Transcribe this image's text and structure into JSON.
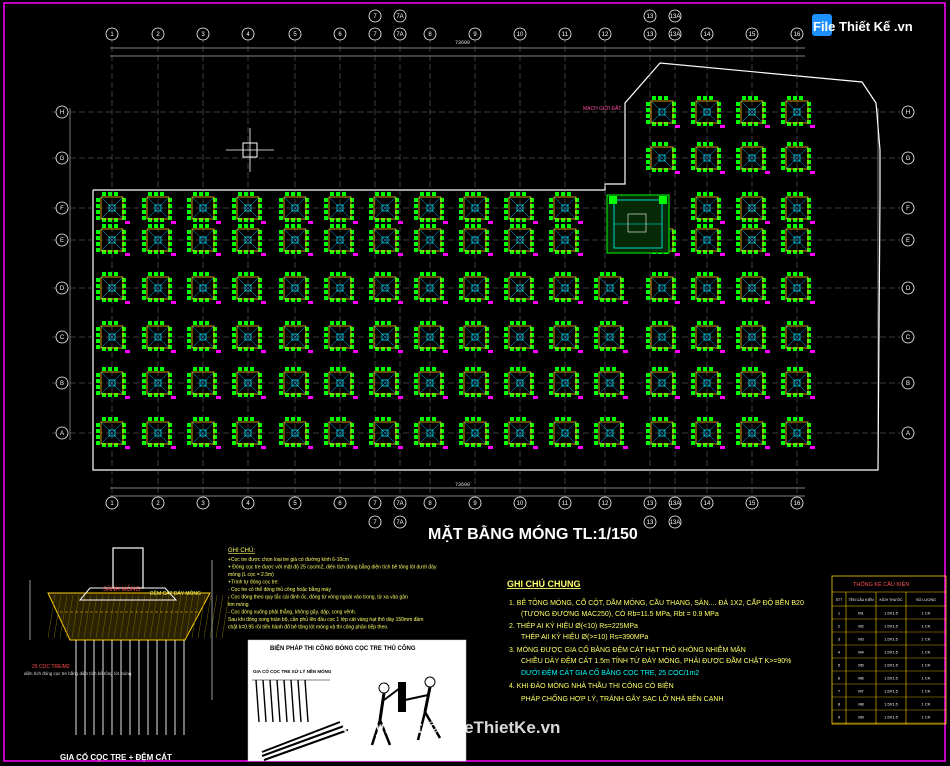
{
  "logo": {
    "text": "File Thiết Kế .vn"
  },
  "watermark": {
    "text": "Copyright © FileThietKe.vn"
  },
  "plan": {
    "title": "MẶT BẰNG MÓNG TL:1/150",
    "axis_numbers": [
      "1",
      "2",
      "3",
      "4",
      "5",
      "6",
      "7",
      "7A",
      "8",
      "9",
      "10",
      "11",
      "12",
      "13",
      "13A",
      "14",
      "15",
      "16"
    ],
    "axis_letters_top_to_bottom": [
      "H",
      "G",
      "F",
      "E",
      "D",
      "C",
      "B",
      "A"
    ],
    "total_width_label": "73600"
  },
  "general_notes": {
    "heading": "GHI CHÚ CHUNG",
    "items": [
      "1. BÊ TÔNG MÓNG, CỔ CỘT, DẦM MÓNG, CẦU THANG, SÀN.... ĐÁ 1X2, CẤP ĐỘ BỀN B20",
      "(TƯƠNG ĐƯƠNG MAC250), CÓ Rb=11.5 MPa, Rbt = 0.9 MPa",
      "2. THÉP AI KÝ HIỆU Ø(<10) Rs=225MPa",
      "THÉP AII KÝ HIỆU Ø(>=10) Rs=390MPa",
      "3. MÓNG ĐƯỢC GIA CỐ BẰNG ĐỆM CÁT HẠT THÔ KHÔNG NHIỄM MẶN",
      "CHIỀU DÀY ĐỆM CÁT 1.5m TÍNH TỪ ĐÁY MÓNG, PHẢI ĐƯỢC ĐẦM CHẶT K>=90%",
      "DƯỚI ĐỆM CÁT GIA CỐ BẰNG CỌC TRE, 25 CỌC/1m2",
      "4. KHI ĐÀO MÓNG NHÀ THẦU THI CÔNG CÓ BIỆN",
      "PHÁP CHỐNG HỢP LÝ, TRÁNH GÂY SẠC LỞ NHÀ BÊN CẠNH"
    ]
  },
  "small_notes": {
    "heading": "GHI CHÚ:",
    "items": [
      "+Cọc tre được chọn loại tre già có đường kính 6-10cm",
      "+ Đóng cọc tre được với mật độ 25 cọc/m2, diện tích đóng bằng diện tích bê tông lót dưới đáy",
      "móng (L cọc = 2.5m)",
      "+Trình tự đóng cọc tre:",
      "- Cọc tre có thể đóng thủ công hoặc bằng máy",
      "- Cọc đóng theo quy tắc cái đinh ốc, đóng từ vòng ngoài vào trong, từ xa vào gần",
      "tim móng",
      "- Cọc đóng xuống phải thẳng, không gãy, dập, cong vênh.",
      "Sau khi đóng xong toàn bộ, cần phủ lên đầu cọc 1 lớp cát vàng hạt thô dày 150mm đầm",
      "chặt k=0.95 rồi tiến hành đổ bê tông lót móng và thi công phần tiếp theo."
    ]
  },
  "section": {
    "caption": "GIA CỐ CỌC TRE + ĐỆM CÁT",
    "labels": [
      "SÀNH MÓNG",
      "ĐỆM CÁT ĐÁY MÓNG",
      "25 CỌC TRE/M2",
      "diện tích đóng cọc tre bằng diện tích bê tông lót móng"
    ]
  },
  "method": {
    "title": "BIỆN PHÁP THI CÔNG ĐÓNG CỌC TRE THỦ CÔNG",
    "subtitle": "GIA CỐ CỌC TRE XỬ LÝ NỀN MÓNG"
  },
  "schedule": {
    "title": "THỐNG KÊ CẤU KIỆN",
    "headers": [
      "STT",
      "TÊN CẤU KIỆN",
      "KÍCH THƯỚC",
      "SỐ LƯỢNG"
    ],
    "rows": [
      [
        "1",
        "M1",
        "1.5X1.5",
        "1 CK"
      ],
      [
        "2",
        "M2",
        "1.5X1.5",
        "1 CK"
      ],
      [
        "3",
        "M3",
        "1.5X1.5",
        "1 CK"
      ],
      [
        "4",
        "M4",
        "1.5X1.5",
        "1 CK"
      ],
      [
        "5",
        "M5",
        "1.5X1.5",
        "1 CK"
      ],
      [
        "6",
        "M6",
        "1.5X1.5",
        "1 CK"
      ],
      [
        "7",
        "M7",
        "1.5X1.5",
        "1 CK"
      ],
      [
        "8",
        "M8",
        "1.5X1.5",
        "1 CK"
      ],
      [
        "9",
        "M9",
        "1.5X1.5",
        "1 CK"
      ]
    ]
  },
  "colors": {
    "frame": "#c0c0c0",
    "grid": "#7a7a7a",
    "footing": "#00ff00",
    "pile_box": "#ffc000",
    "column": "#00e0ff",
    "tag": "#ff00ff",
    "note_blue": "#66b3ff",
    "note_cyan": "#00ffff",
    "title_white": "#ffffff",
    "logo": "#1e90ff"
  }
}
